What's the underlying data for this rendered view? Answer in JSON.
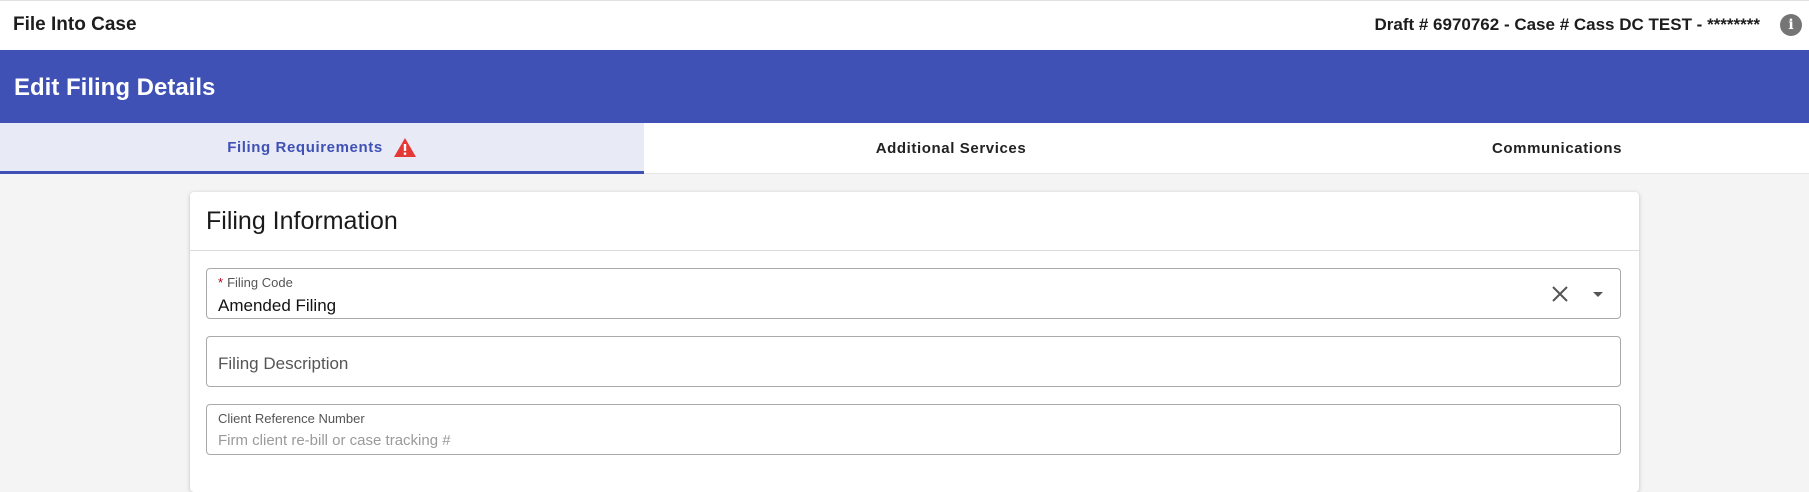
{
  "topbar": {
    "title": "File Into Case",
    "draft_info": "Draft # 6970762 - Case # Cass DC TEST - ********",
    "info_icon": "info-icon"
  },
  "header": {
    "title": "Edit Filing Details",
    "color": "#3f51b5"
  },
  "tabs": [
    {
      "label": "Filing Requirements",
      "active": true,
      "icon": "warning-icon"
    },
    {
      "label": "Additional Services",
      "active": false
    },
    {
      "label": "Communications",
      "active": false
    }
  ],
  "card": {
    "title": "Filing Information",
    "fields": {
      "filing_code": {
        "label": "Filing Code",
        "required_marker": "*",
        "value": "Amended Filing"
      },
      "filing_description": {
        "placeholder": "Filing Description"
      },
      "client_reference": {
        "label": "Client Reference Number",
        "placeholder": "Firm client re-bill or case tracking #"
      }
    }
  },
  "colors": {
    "accent": "#3f51b5",
    "active_tab_bg": "#e8eaf6",
    "warning": "#e53935",
    "required": "#b00020"
  }
}
